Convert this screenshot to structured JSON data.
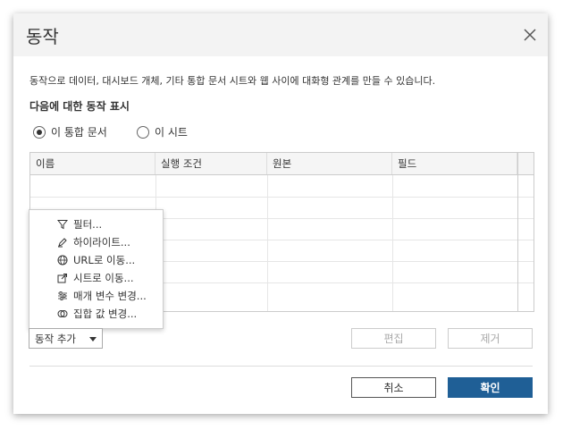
{
  "dialog": {
    "title": "동작",
    "description": "동작으로 데이터, 대시보드 개체, 기타 통합 문서 시트와 웹 사이에 대화형 관계를 만들 수 있습니다.",
    "section_label": "다음에 대한 동작 표시",
    "radios": [
      {
        "label": "이 통합 문서",
        "selected": true
      },
      {
        "label": "이 시트",
        "selected": false
      }
    ],
    "table": {
      "columns": [
        "이름",
        "실행 조건",
        "원본",
        "필드"
      ],
      "rows": []
    },
    "add_menu": {
      "items": [
        {
          "label": "필터...",
          "icon": "filter-icon"
        },
        {
          "label": "하이라이트...",
          "icon": "highlighter-icon"
        },
        {
          "label": "URL로 이동...",
          "icon": "globe-icon"
        },
        {
          "label": "시트로 이동...",
          "icon": "go-to-sheet-icon"
        },
        {
          "label": "매개 변수 변경...",
          "icon": "parameter-sliders-icon"
        },
        {
          "label": "집합 값 변경...",
          "icon": "set-icon"
        }
      ]
    },
    "add_button": "동작 추가",
    "edit_button": "편집",
    "remove_button": "제거",
    "cancel_button": "취소",
    "ok_button": "확인"
  },
  "colors": {
    "primary": "#1f5f96",
    "titlebar": "#f3f3f3"
  }
}
